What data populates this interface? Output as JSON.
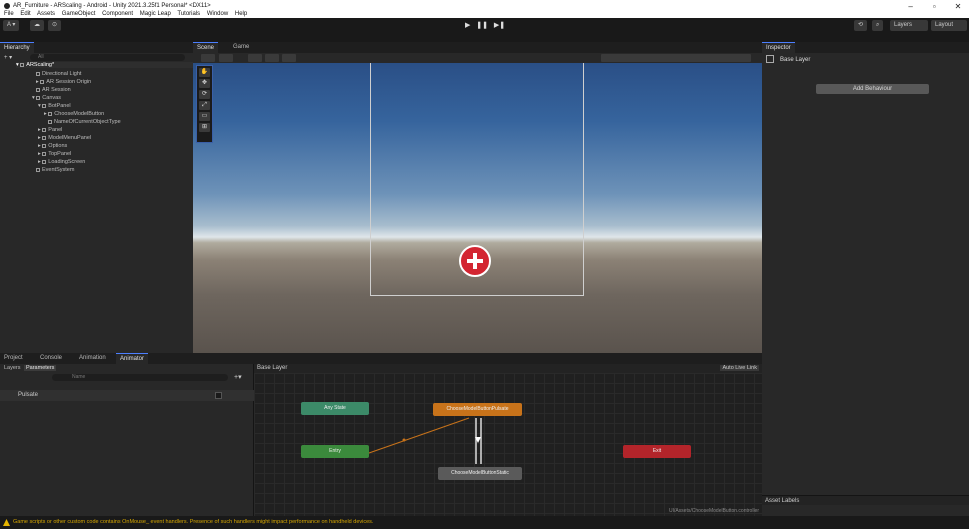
{
  "window": {
    "title": "AR_Furniture - ARScaling - Android - Unity 2021.3.25f1 Personal* <DX11>",
    "menu": [
      "File",
      "Edit",
      "Assets",
      "GameObject",
      "Component",
      "Magic Leap",
      "Tutorials",
      "Window",
      "Help"
    ],
    "controls": [
      "–",
      "▫",
      "✕"
    ]
  },
  "toolbar": {
    "account": "A ▾",
    "cloud": "☁",
    "collab": "⊙",
    "play": "▶",
    "pause": "❚❚",
    "step": "▶❚",
    "history": "⟲",
    "search": "⌕",
    "layers": "Layers",
    "layout": "Layout"
  },
  "hierarchy": {
    "tab": "Hierarchy",
    "add": "+ ▾",
    "search_placeholder": "All",
    "scene": "ARScaling*",
    "items": [
      "Directional Light",
      "AR Session Origin",
      "AR Session",
      "Canvas",
      "BotPanel",
      "ChooseModelButton",
      "NameOfCurrentObjectType",
      "Panel",
      "ModelMenuPanel",
      "Options",
      "TopPanel",
      "LoadingScreen",
      "EventSystem"
    ]
  },
  "scene": {
    "tabs": [
      "Scene",
      "Game"
    ],
    "tools": [
      "✋",
      "✥",
      "⟳",
      "⤢",
      "▭",
      "⊞"
    ]
  },
  "inspector": {
    "tab": "Inspector",
    "object": "Base Layer",
    "add_behaviour": "Add Behaviour",
    "asset_labels": "Asset Labels"
  },
  "bottom": {
    "tabs": [
      "Project",
      "Console",
      "Animation",
      "Animator"
    ],
    "subtabs": [
      "Layers",
      "Parameters"
    ],
    "search_placeholder": "Name",
    "param": "Pulsate",
    "breadcrumb": "Base Layer",
    "auto_live_link": "Auto Live Link",
    "path": "UI/Assets/ChooseModelButton.controller"
  },
  "graph": {
    "nodes": [
      {
        "label": "Any State",
        "color": "#3c8a68"
      },
      {
        "label": "ChooseModelButtonPulsate",
        "color": "#c8731a"
      },
      {
        "label": "Entry",
        "color": "#3b8a3c"
      },
      {
        "label": "Exit",
        "color": "#b3242a"
      },
      {
        "label": "ChooseModelButtonStatic",
        "color": "#5a5a5a"
      }
    ]
  },
  "status": {
    "message": "Game scripts or other custom code contains OnMouse_ event handlers. Presence of such handlers might impact performance on handheld devices."
  }
}
